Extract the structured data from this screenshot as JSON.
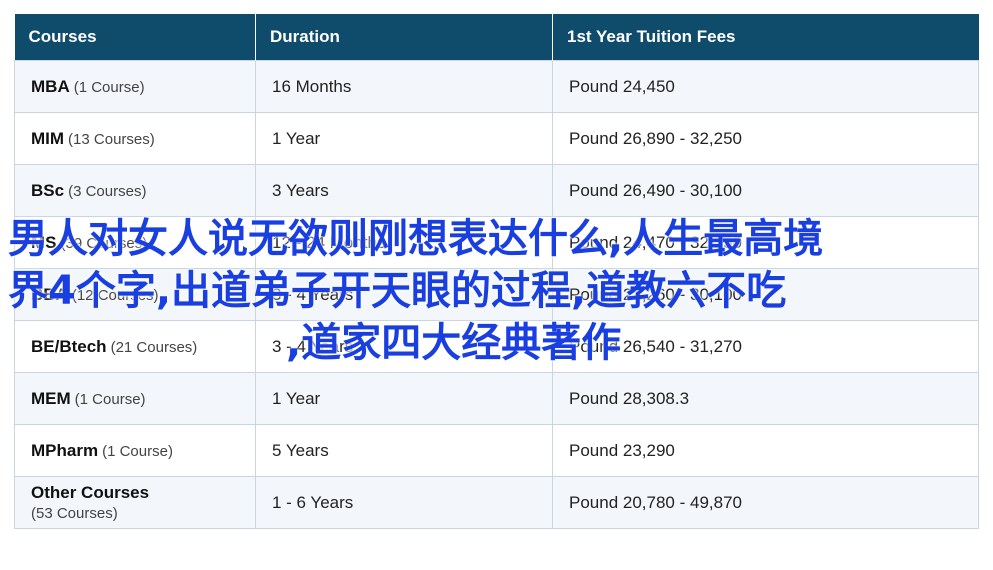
{
  "table": {
    "headers": [
      "Courses",
      "Duration",
      "1st Year Tuition Fees"
    ],
    "rows": [
      {
        "name": "MBA",
        "count": "(1 Course)",
        "duration": "16 Months",
        "fees": "Pound 24,450"
      },
      {
        "name": "MIM",
        "count": "(13 Courses)",
        "duration": "1 Year",
        "fees": "Pound 26,890 - 32,250"
      },
      {
        "name": "BSc",
        "count": "(3 Courses)",
        "duration": "3 Years",
        "fees": "Pound 26,490 - 30,100"
      },
      {
        "name": "MS",
        "count": "(39 Courses)",
        "duration": "12 - 24 Months",
        "fees": "Pound 24,470 - 32,250"
      },
      {
        "name": "BBA",
        "count": "(12 Courses)",
        "duration": "3 - 4 Years",
        "fees": "Pound 21,260 - 30,100"
      },
      {
        "name": "BE/Btech",
        "count": "(21 Courses)",
        "duration": "3 - 4 Years",
        "fees": "Pound 26,540 - 31,270"
      },
      {
        "name": "MEM",
        "count": "(1 Course)",
        "duration": "1 Year",
        "fees": "Pound 28,308.3"
      },
      {
        "name": "MPharm",
        "count": "(1 Course)",
        "duration": "5 Years",
        "fees": "Pound 23,290"
      },
      {
        "name": "Other Courses",
        "count": "(53 Courses)",
        "duration": "1 - 6 Years",
        "fees": "Pound 20,780 - 49,870"
      }
    ]
  },
  "overlay": {
    "line1": "男人对女人说无欲则刚想表达什么,人生最高境",
    "line2": "界4个字,出道弟子开天眼的过程,道教六不吃",
    "line3": ",道家四大经典著作"
  }
}
